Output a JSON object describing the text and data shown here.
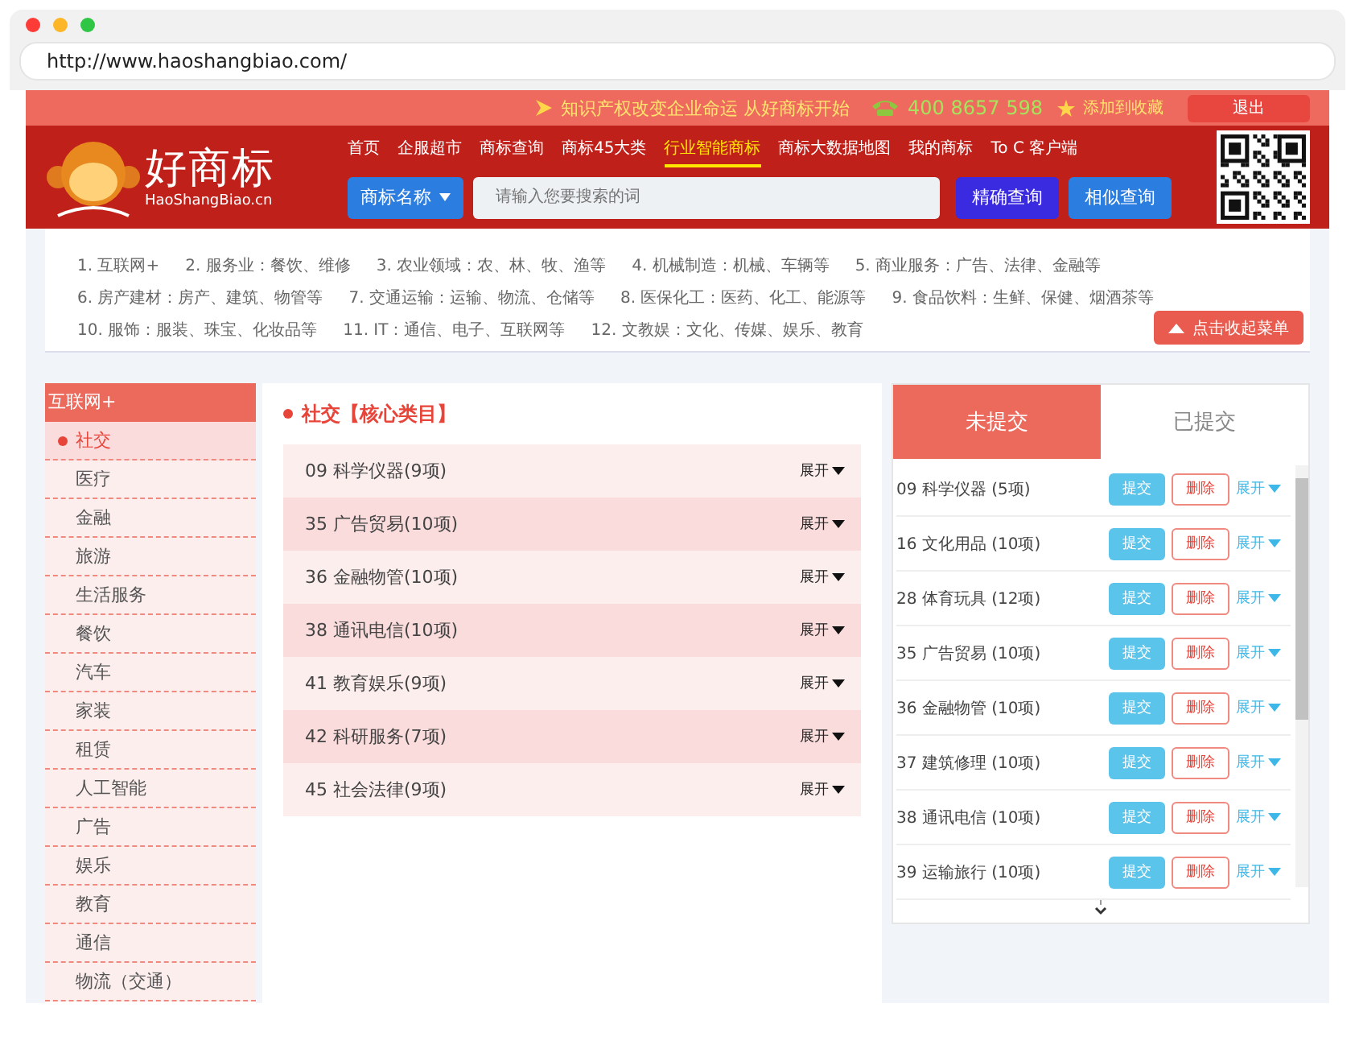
{
  "browser": {
    "url": "http://www.haoshangbiao.com/"
  },
  "top_bar": {
    "slogan": "知识产权改变企业命运 从好商标开始",
    "phone": "400 8657 598",
    "favorite": "添加到收藏",
    "logout": "退出"
  },
  "logo": {
    "name": "好商标",
    "domain": "HaoShangBiao.cn"
  },
  "nav": [
    {
      "label": "首页",
      "selected": false
    },
    {
      "label": "企服超市",
      "selected": false
    },
    {
      "label": "商标查询",
      "selected": false
    },
    {
      "label": "商标45大类",
      "selected": false
    },
    {
      "label": "行业智能商标",
      "selected": true
    },
    {
      "label": "商标大数据地图",
      "selected": false
    },
    {
      "label": "我的商标",
      "selected": false
    },
    {
      "label": "To C 客户端",
      "selected": false
    }
  ],
  "search": {
    "type": "商标名称",
    "placeholder": "请输入您要搜索的词",
    "buttons": [
      "精确查询",
      "相似查询"
    ]
  },
  "industries": [
    [
      "1. 互联网+",
      "2. 服务业：餐饮、维修",
      "3. 农业领域：农、林、牧、渔等",
      "4. 机械制造：机械、车辆等",
      "5. 商业服务：广告、法律、金融等"
    ],
    [
      "6. 房产建材：房产、建筑、物管等",
      "7. 交通运输：运输、物流、仓储等",
      "8. 医保化工：医药、化工、能源等",
      "9. 食品饮料：生鲜、保健、烟酒茶等"
    ],
    [
      "10. 服饰：服装、珠宝、化妆品等",
      "11. IT：通信、电子、互联网等",
      "12. 文教娱：文化、传媒、娱乐、教育"
    ]
  ],
  "collapse_button": "点击收起菜单",
  "sidebar": {
    "title": "互联网+",
    "items": [
      {
        "label": "社交",
        "selected": true
      },
      {
        "label": "医疗",
        "selected": false
      },
      {
        "label": "金融",
        "selected": false
      },
      {
        "label": "旅游",
        "selected": false
      },
      {
        "label": "生活服务",
        "selected": false
      },
      {
        "label": "餐饮",
        "selected": false
      },
      {
        "label": "汽车",
        "selected": false
      },
      {
        "label": "家装",
        "selected": false
      },
      {
        "label": "租赁",
        "selected": false
      },
      {
        "label": "人工智能",
        "selected": false
      },
      {
        "label": "广告",
        "selected": false
      },
      {
        "label": "娱乐",
        "selected": false
      },
      {
        "label": "教育",
        "selected": false
      },
      {
        "label": "通信",
        "selected": false
      },
      {
        "label": "物流（交通）",
        "selected": false
      }
    ]
  },
  "classes": {
    "title": "社交【核心类目】",
    "rows": [
      {
        "name": "09 科学仪器(9项)",
        "expand": "展开"
      },
      {
        "name": "35 广告贸易(10项)",
        "expand": "展开"
      },
      {
        "name": "36 金融物管(10项)",
        "expand": "展开"
      },
      {
        "name": "38 通讯电信(10项)",
        "expand": "展开"
      },
      {
        "name": "41 教育娱乐(9项)",
        "expand": "展开"
      },
      {
        "name": "42 科研服务(7项)",
        "expand": "展开"
      },
      {
        "name": "45 社会法律(9项)",
        "expand": "展开"
      }
    ]
  },
  "basket": {
    "tabs": [
      {
        "label": "未提交",
        "selected": true
      },
      {
        "label": "已提交",
        "selected": false
      }
    ],
    "rows": [
      {
        "name": "09 科学仪器 (5项)",
        "submit": "提交",
        "delete": "删除",
        "expand": "展开"
      },
      {
        "name": "16 文化用品 (10项)",
        "submit": "提交",
        "delete": "删除",
        "expand": "展开"
      },
      {
        "name": "28 体育玩具 (12项)",
        "submit": "提交",
        "delete": "删除",
        "expand": "展开"
      },
      {
        "name": "35 广告贸易 (10项)",
        "submit": "提交",
        "delete": "删除",
        "expand": "展开"
      },
      {
        "name": "36 金融物管 (10项)",
        "submit": "提交",
        "delete": "删除",
        "expand": "展开"
      },
      {
        "name": "37 建筑修理 (10项)",
        "submit": "提交",
        "delete": "删除",
        "expand": "展开"
      },
      {
        "name": "38 通讯电信 (10项)",
        "submit": "提交",
        "delete": "删除",
        "expand": "展开"
      },
      {
        "name": "39 运输旅行 (10项)",
        "submit": "提交",
        "delete": "删除",
        "expand": "展开"
      }
    ]
  }
}
